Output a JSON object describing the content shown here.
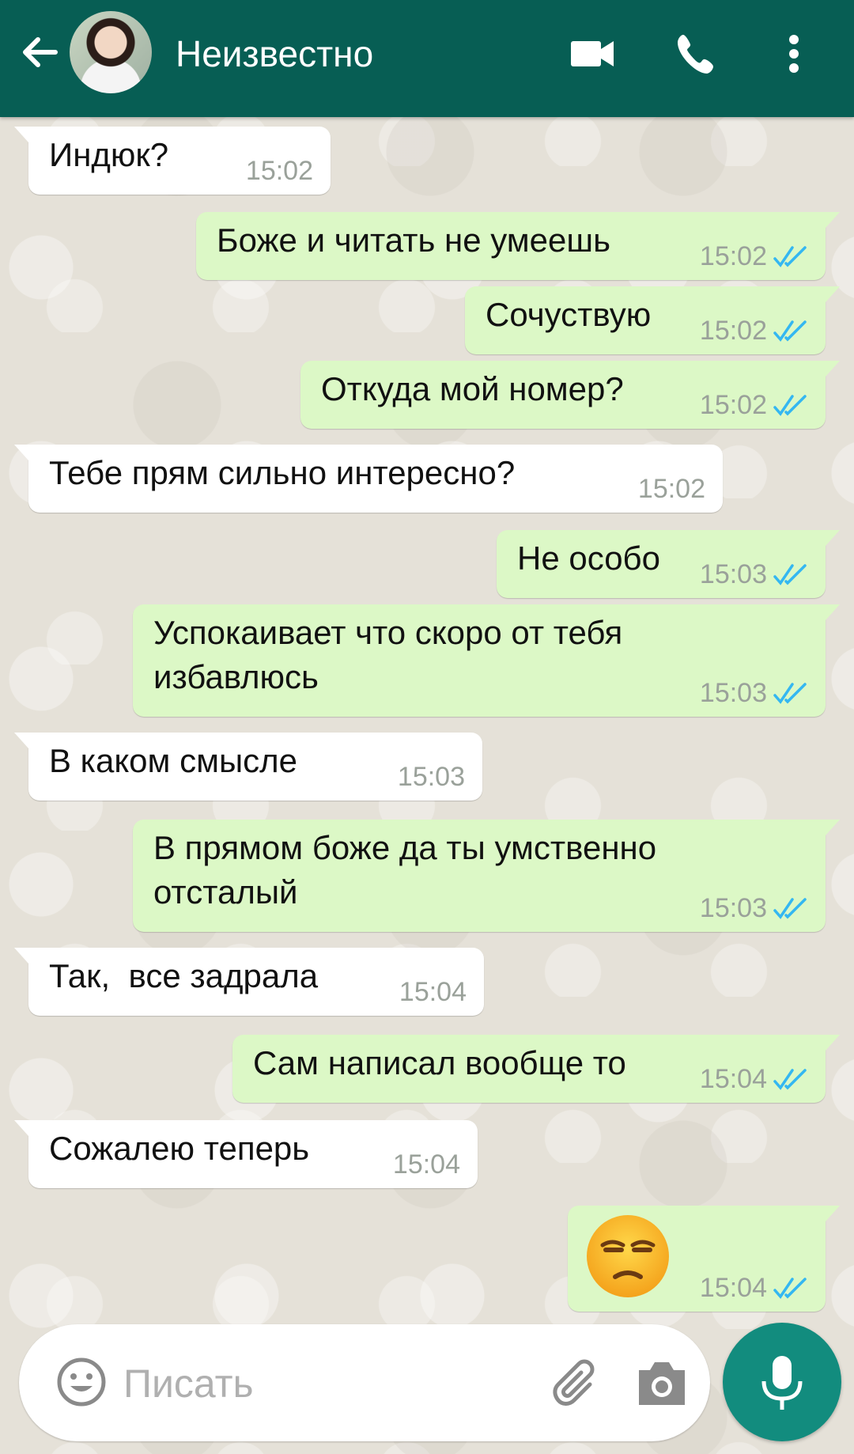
{
  "header": {
    "contact_name": "Неизвестно",
    "color": "#075e54",
    "icons": [
      "back-arrow-icon",
      "video-call-icon",
      "phone-icon",
      "more-vert-icon"
    ]
  },
  "messages": [
    {
      "dir": "in",
      "text": "Индюк?",
      "time": "15:02"
    },
    {
      "dir": "out",
      "text": "Боже и читать не умеешь",
      "time": "15:02"
    },
    {
      "dir": "out",
      "text": "Сочуствую",
      "time": "15:02"
    },
    {
      "dir": "out",
      "text": "Откуда мой номер?",
      "time": "15:02"
    },
    {
      "dir": "in",
      "text": "Тебе прям сильно интересно?",
      "time": "15:02"
    },
    {
      "dir": "out",
      "text": "Не особо",
      "time": "15:03"
    },
    {
      "dir": "out",
      "text": "Успокаивает что скоро от тебя\nизбавлюсь",
      "time": "15:03"
    },
    {
      "dir": "in",
      "text": "В каком смысле",
      "time": "15:03"
    },
    {
      "dir": "out",
      "text": "В прямом боже да ты умственно\nотсталый",
      "time": "15:03"
    },
    {
      "dir": "in",
      "text": "Так,  все задрала",
      "time": "15:04"
    },
    {
      "dir": "out",
      "text": "Сам написал вообще то",
      "time": "15:04"
    },
    {
      "dir": "in",
      "text": "Сожалею теперь",
      "time": "15:04"
    },
    {
      "dir": "out",
      "emoji": "unamused-face-emoji",
      "time": "15:04"
    }
  ],
  "colors": {
    "incoming_bubble": "#ffffff",
    "outgoing_bubble": "#dcf8c6",
    "read_ticks": "#34b7f1",
    "mic_button": "#128c7e"
  },
  "input": {
    "placeholder": "Писать"
  }
}
